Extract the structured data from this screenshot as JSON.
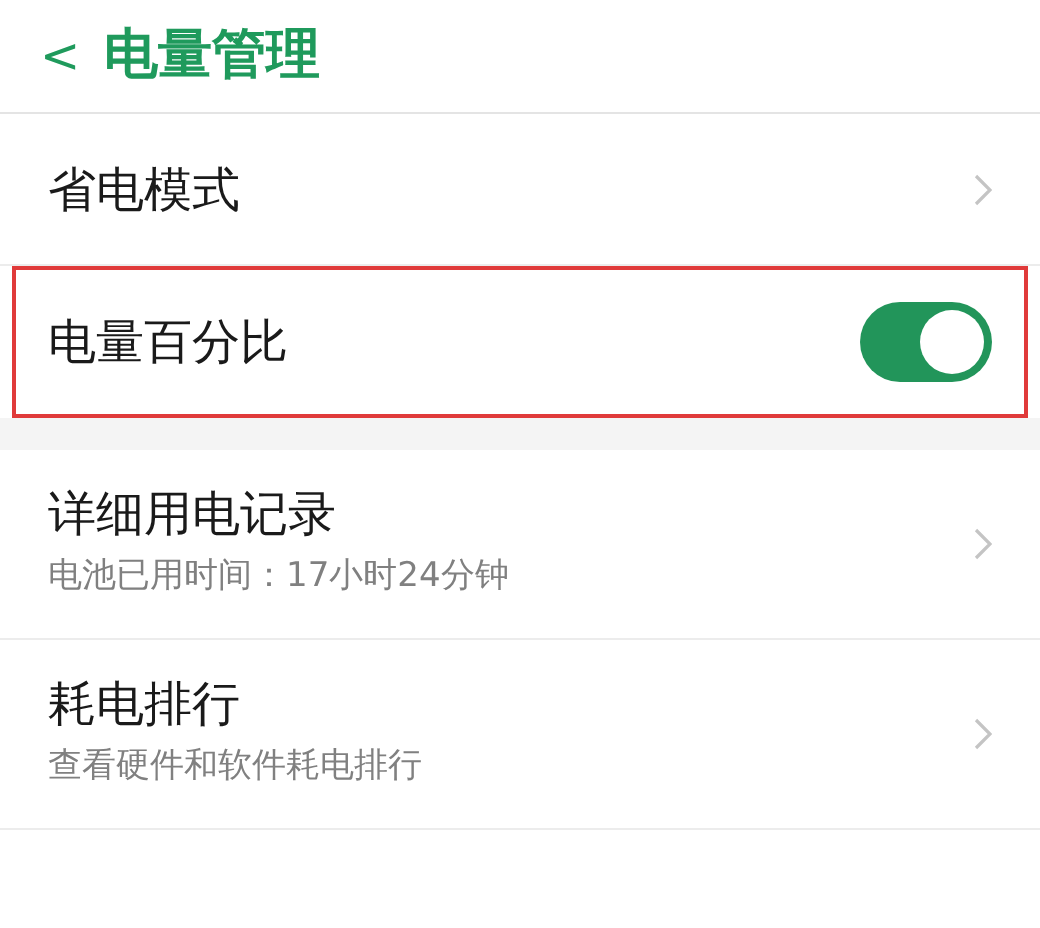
{
  "header": {
    "back": "<",
    "title": "电量管理"
  },
  "groups": [
    {
      "items": [
        {
          "kind": "link",
          "title": "省电模式",
          "highlighted": false
        },
        {
          "kind": "toggle",
          "title": "电量百分比",
          "on": true,
          "highlighted": true
        }
      ]
    },
    {
      "items": [
        {
          "kind": "link",
          "title": "详细用电记录",
          "subtitle": "电池已用时间：17小时24分钟",
          "highlighted": false
        },
        {
          "kind": "link",
          "title": "耗电排行",
          "subtitle": "查看硬件和软件耗电排行",
          "highlighted": false
        }
      ]
    }
  ]
}
